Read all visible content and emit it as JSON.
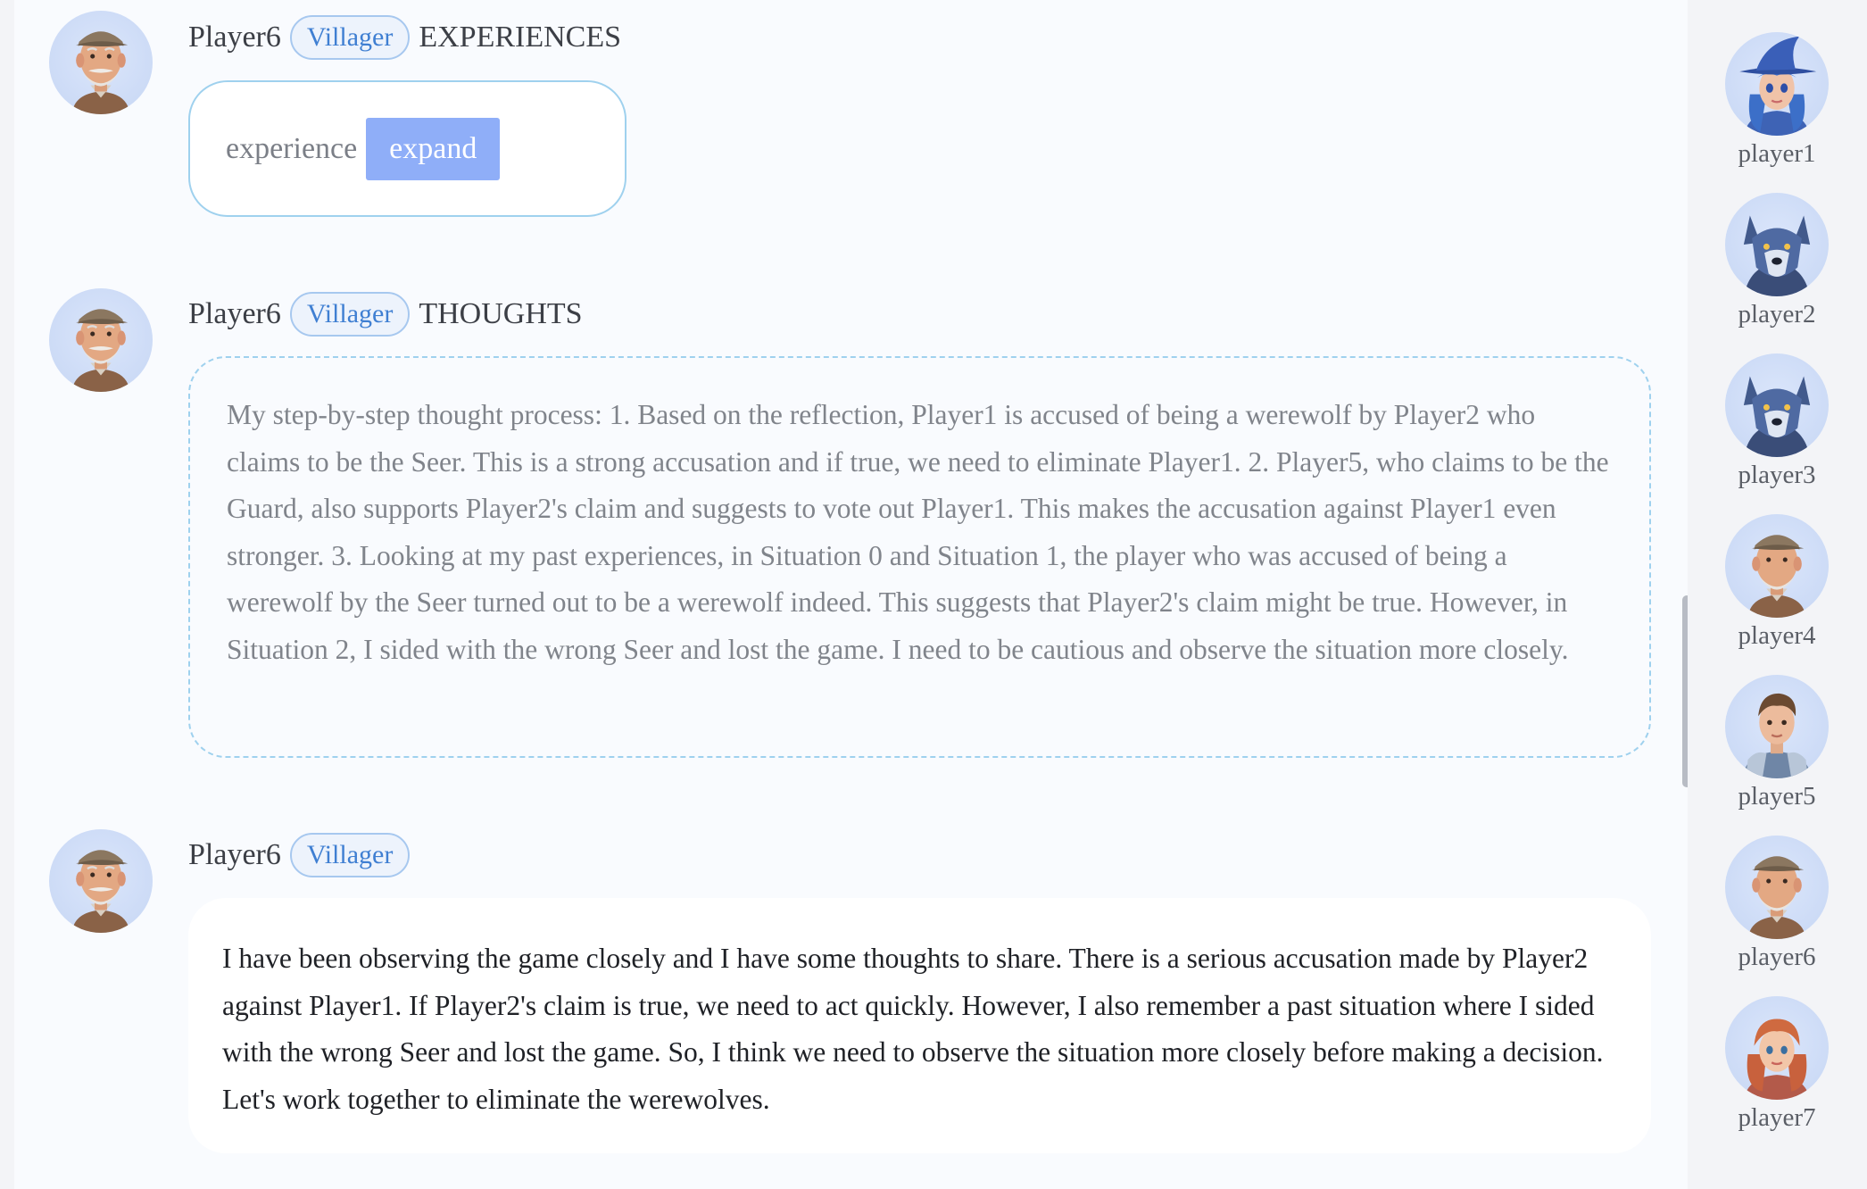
{
  "messages": [
    {
      "player": "Player6",
      "role": "Villager",
      "kind": "EXPERIENCES",
      "experience_label": "experience",
      "expand_label": "expand"
    },
    {
      "player": "Player6",
      "role": "Villager",
      "kind": "THOUGHTS",
      "text": "My step-by-step thought process: 1. Based on the reflection, Player1 is accused of being a werewolf by Player2 who claims to be the Seer. This is a strong accusation and if true, we need to eliminate Player1. 2. Player5, who claims to be the Guard, also supports Player2's claim and suggests to vote out Player1. This makes the accusation against Player1 even stronger. 3. Looking at my past experiences, in Situation 0 and Situation 1, the player who was accused of being a werewolf by the Seer turned out to be a werewolf indeed. This suggests that Player2's claim might be true. However, in Situation 2, I sided with the wrong Seer and lost the game. I need to be cautious and observe the situation more closely."
    },
    {
      "player": "Player6",
      "role": "Villager",
      "text": "I have been observing the game closely and I have some thoughts to share. There is a serious accusation made by Player2 against Player1. If Player2's claim is true, we need to act quickly. However, I also remember a past situation where I sided with the wrong Seer and lost the game. So, I think we need to observe the situation more closely before making a decision. Let's work together to eliminate the werewolves."
    }
  ],
  "sidebar": {
    "players": [
      {
        "name": "player1",
        "avatar": "witch-avatar-icon"
      },
      {
        "name": "player2",
        "avatar": "wolf-avatar-icon"
      },
      {
        "name": "player3",
        "avatar": "wolf-avatar-icon"
      },
      {
        "name": "player4",
        "avatar": "old-man-avatar-icon"
      },
      {
        "name": "player5",
        "avatar": "guard-avatar-icon"
      },
      {
        "name": "player6",
        "avatar": "old-man-avatar-icon"
      },
      {
        "name": "player7",
        "avatar": "girl-avatar-icon"
      }
    ]
  },
  "colors": {
    "badge_text": "#3f7fd2",
    "badge_border": "#a7c8ef",
    "box_border": "#9fd1ee",
    "expand_button": "#8faef8"
  }
}
